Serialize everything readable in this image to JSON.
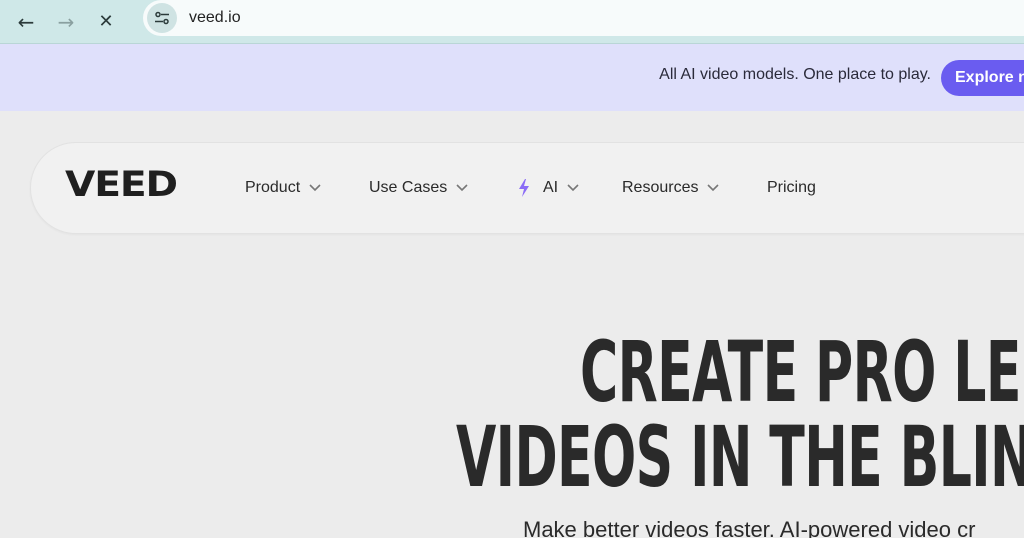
{
  "browser": {
    "back_icon": "arrow-left-icon",
    "forward_icon": "arrow-right-icon",
    "stop_icon": "close-icon",
    "site_info_icon": "tune-icon",
    "url": "veed.io"
  },
  "promo": {
    "text": "All AI video models. One place to play.",
    "button_label": "Explore n"
  },
  "header": {
    "logo": "VEED",
    "menu": [
      {
        "label": "Product",
        "has_dropdown": true
      },
      {
        "label": "Use Cases",
        "has_dropdown": true
      },
      {
        "label": "AI",
        "has_dropdown": true,
        "icon": "sparkle-icon"
      },
      {
        "label": "Resources",
        "has_dropdown": true
      },
      {
        "label": "Pricing",
        "has_dropdown": false
      }
    ]
  },
  "hero": {
    "title_line1": "CREATE PRO LE",
    "title_line2": "VIDEOS IN THE BLIN",
    "subtitle": "Make better videos faster. AI-powered video cr"
  },
  "colors": {
    "browser_bar": "#cfe8e8",
    "promo_bg": "#dfe0fb",
    "accent": "#6a5cf0",
    "page_bg": "#ececec",
    "spark": "#8b6cf6"
  }
}
